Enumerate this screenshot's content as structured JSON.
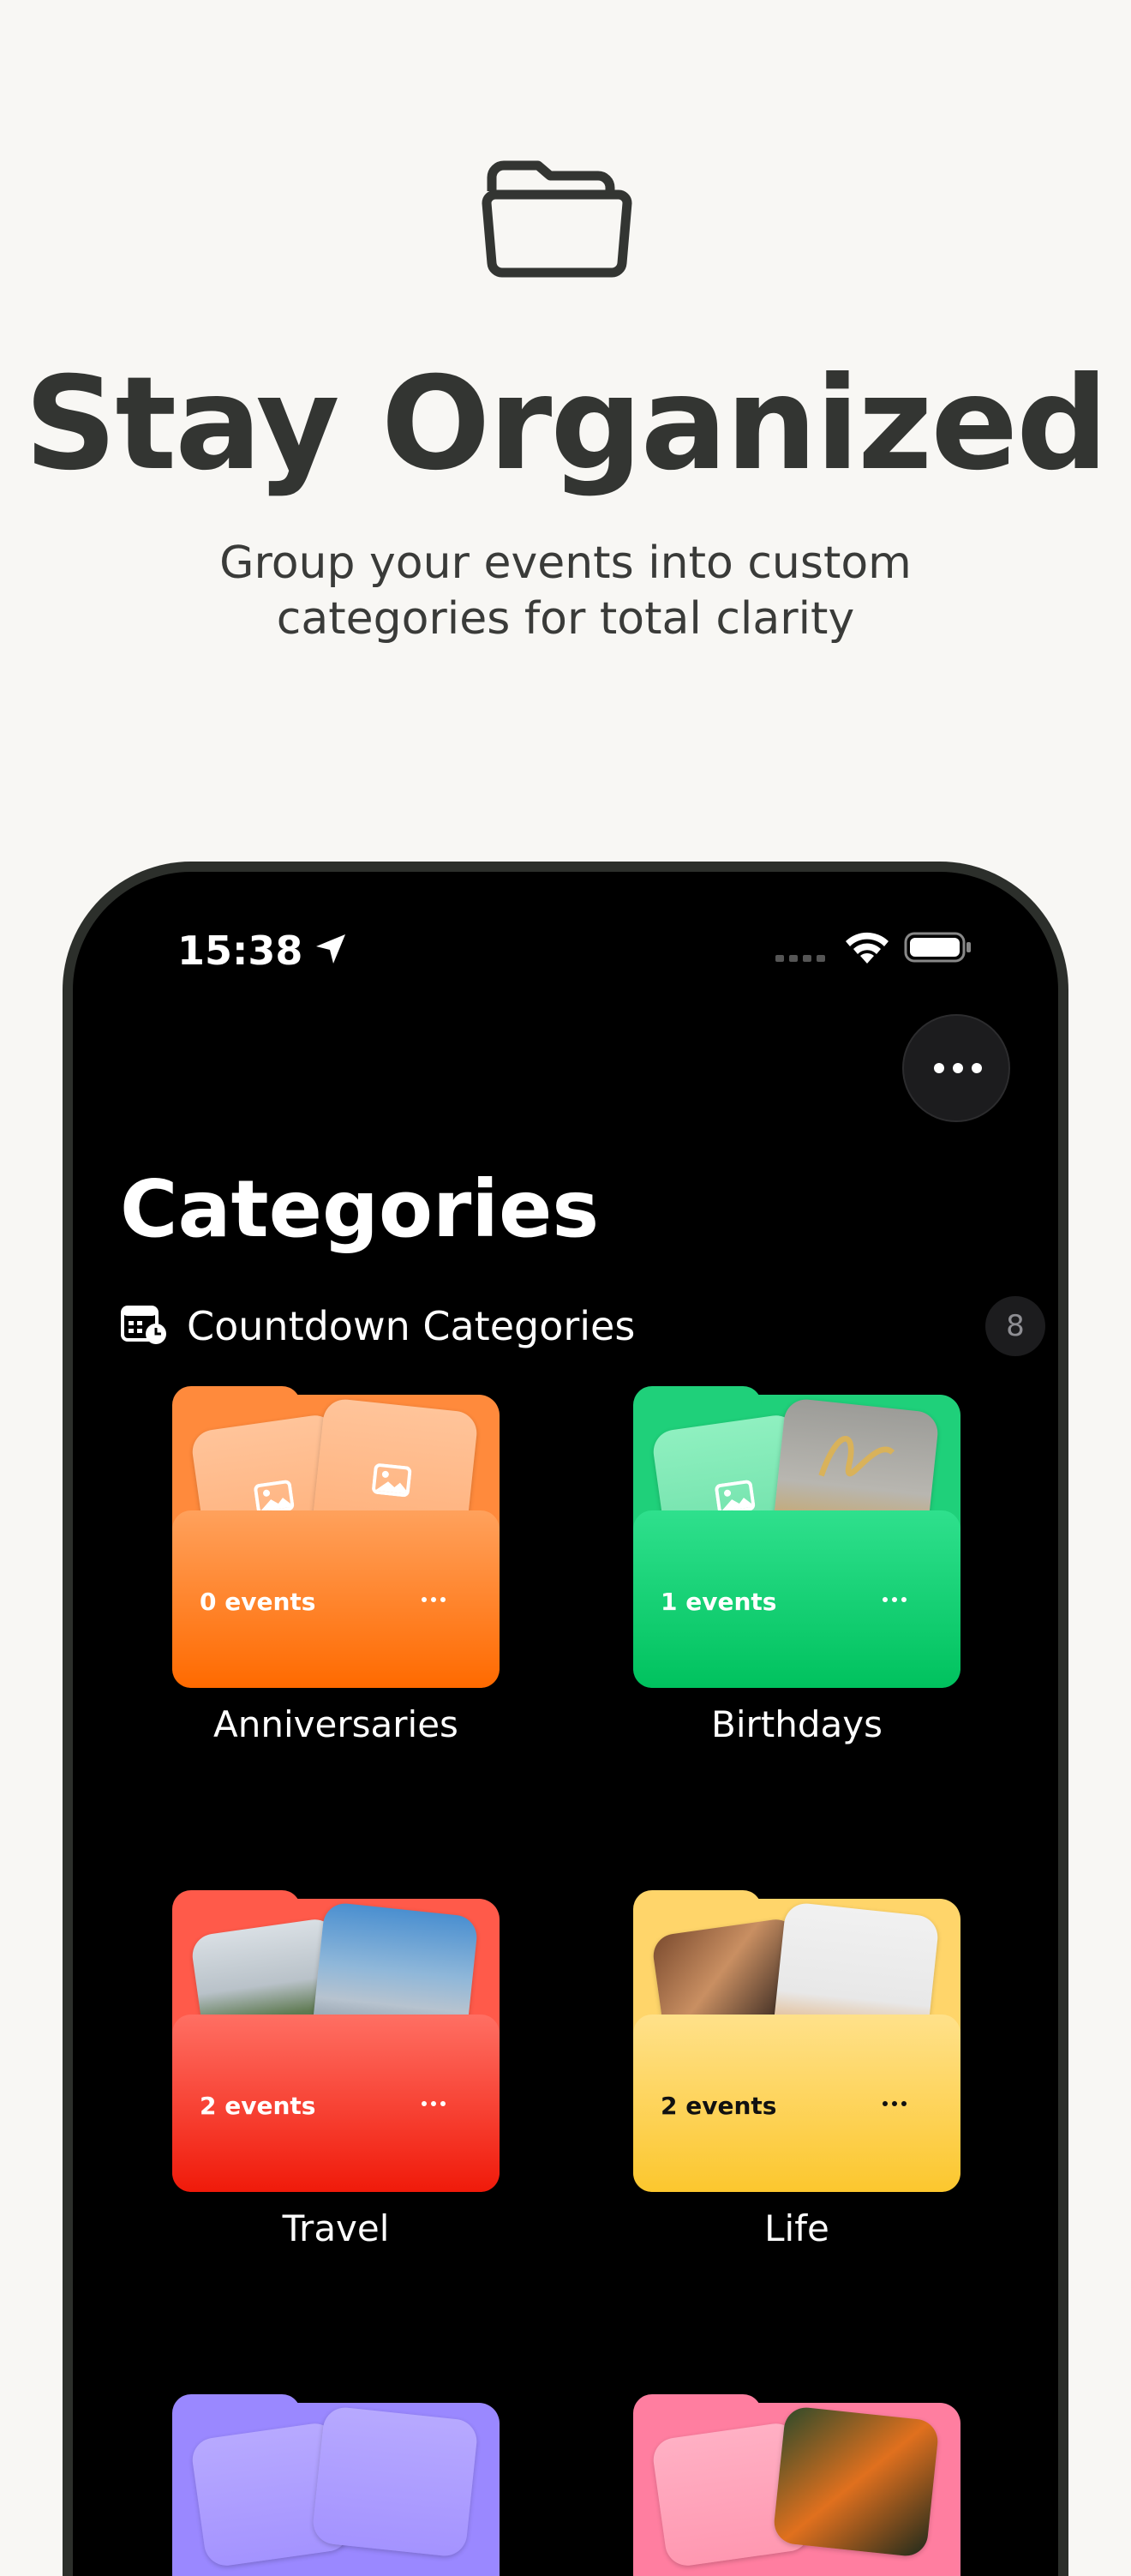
{
  "hero": {
    "icon": "folder-icon",
    "title": "Stay Organized",
    "subtitle_line1": "Group your events into custom",
    "subtitle_line2": "categories for total clarity"
  },
  "status_bar": {
    "time": "15:38",
    "icons": [
      "location-arrow-icon",
      "cellular-signal-icon",
      "wifi-icon",
      "battery-icon"
    ]
  },
  "toolbar": {
    "more_icon": "ellipsis-icon"
  },
  "page_title": "Categories",
  "section": {
    "icon": "calendar-clock-icon",
    "label": "Countdown Categories",
    "count": "8"
  },
  "categories": [
    {
      "name": "Anniversaries",
      "events": "0 events",
      "color": "#ff6a00"
    },
    {
      "name": "Birthdays",
      "events": "1 events",
      "color": "#00c25e"
    },
    {
      "name": "Travel",
      "events": "2 events",
      "color": "#f01a0a"
    },
    {
      "name": "Life",
      "events": "2 events",
      "color": "#fcc72e"
    },
    {
      "name": "",
      "events": "",
      "color": "#9a88ff"
    },
    {
      "name": "",
      "events": "",
      "color": "#ff7ea0"
    }
  ]
}
